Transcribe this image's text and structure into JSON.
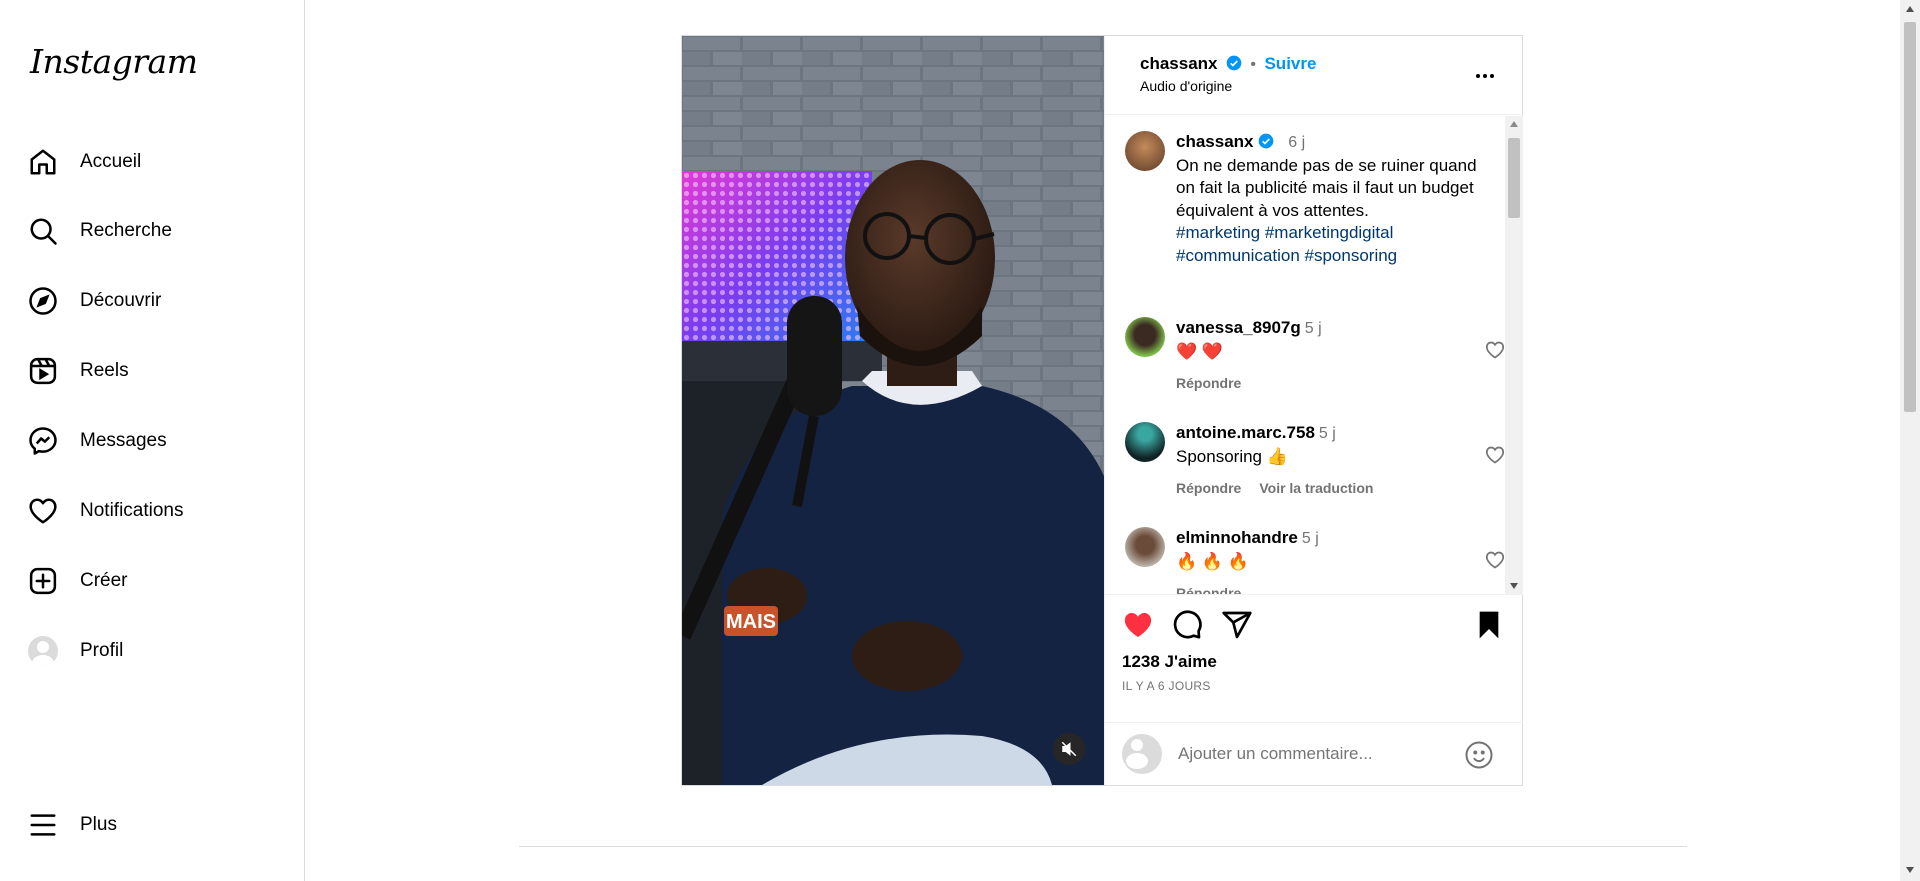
{
  "sidebar": {
    "logo": "Instagram",
    "items": [
      {
        "label": "Accueil",
        "icon": "home-icon"
      },
      {
        "label": "Recherche",
        "icon": "search-icon"
      },
      {
        "label": "Découvrir",
        "icon": "compass-icon"
      },
      {
        "label": "Reels",
        "icon": "reels-icon"
      },
      {
        "label": "Messages",
        "icon": "messenger-icon"
      },
      {
        "label": "Notifications",
        "icon": "heart-icon"
      },
      {
        "label": "Créer",
        "icon": "plus-square-icon"
      },
      {
        "label": "Profil",
        "icon": "avatar"
      }
    ],
    "more": "Plus"
  },
  "post": {
    "author": "chassanx",
    "follow": "Suivre",
    "dot": "•",
    "audio": "Audio d'origine",
    "video_caption_overlay": "MAIS",
    "caption": {
      "author": "chassanx",
      "time": "6 j",
      "text": "On ne demande pas de se ruiner quand on fait la publicité mais il faut un budget équivalent à vos attentes.",
      "hashtags": [
        "#marketing",
        "#marketingdigital",
        "#communication",
        "#sponsoring"
      ]
    },
    "comments": [
      {
        "user": "vanessa_8907g",
        "time": "5 j",
        "text": "❤️ ❤️",
        "reply": "Répondre",
        "translate": ""
      },
      {
        "user": "antoine.marc.758",
        "time": "5 j",
        "text": "Sponsoring 👍",
        "reply": "Répondre",
        "translate": "Voir la traduction"
      },
      {
        "user": "elminnohandre",
        "time": "5 j",
        "text": "🔥 🔥 🔥",
        "reply": "Répondre",
        "translate": ""
      }
    ],
    "likes": "1238 J'aime",
    "date": "IL Y A 6 JOURS",
    "comment_placeholder": "Ajouter un commentaire..."
  },
  "colors": {
    "accent": "#0095f6",
    "like": "#ff3040",
    "hashtag": "#00376b",
    "muted": "#737373"
  }
}
